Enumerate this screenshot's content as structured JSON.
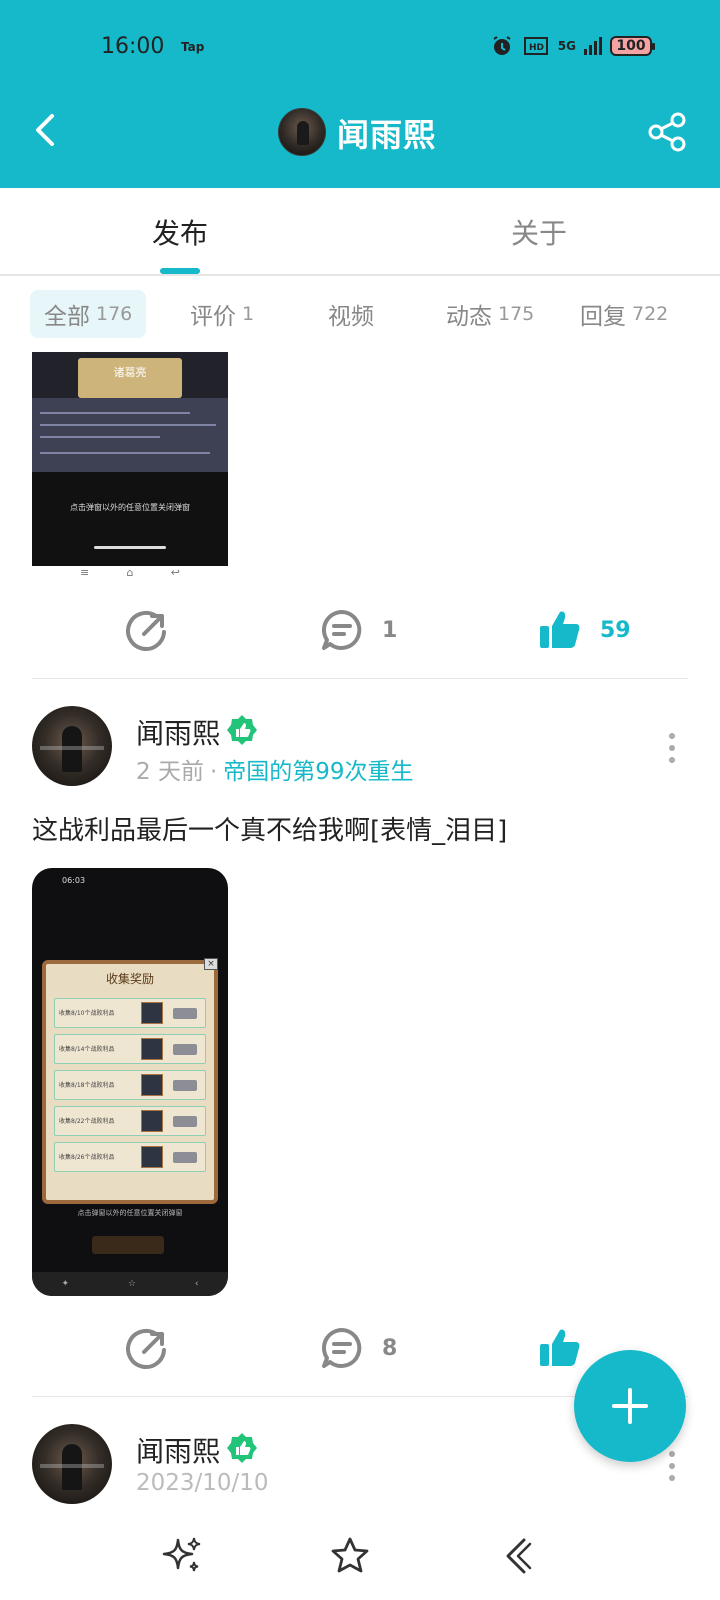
{
  "status": {
    "time": "16:00",
    "tap": "Tap",
    "network": "5G",
    "battery": "100"
  },
  "header": {
    "title": "闻雨熙"
  },
  "tabs": {
    "publish": "发布",
    "about": "关于"
  },
  "filters": [
    {
      "label": "全部",
      "count": "176"
    },
    {
      "label": "评价",
      "count": "1"
    },
    {
      "label": "视频",
      "count": ""
    },
    {
      "label": "动态",
      "count": "175"
    },
    {
      "label": "回复",
      "count": "722"
    }
  ],
  "post0": {
    "image_title": "诸葛亮",
    "image_caption": "点击弹窗以外的任意位置关闭弹窗",
    "comments": "1",
    "likes": "59"
  },
  "post1": {
    "author": "闻雨熙",
    "time_ago": "2 天前",
    "dot": "·",
    "topic": "帝国的第99次重生",
    "text": "这战利品最后一个真不给我啊[表情_泪目]",
    "image_status_time": "06:03",
    "image_title": "收集奖励",
    "image_rows": [
      "收集8/10个战败利品",
      "收集8/14个战败利品",
      "收集8/18个战败利品",
      "收集8/22个战败利品",
      "收集8/26个战败利品"
    ],
    "image_footer": "点击弹窗以外的任意位置关闭弹窗",
    "comments": "8",
    "likes": ""
  },
  "post2": {
    "author": "闻雨熙",
    "date": "2023/10/10"
  },
  "colors": {
    "accent": "#16b9c9",
    "badge": "#22c47a"
  }
}
